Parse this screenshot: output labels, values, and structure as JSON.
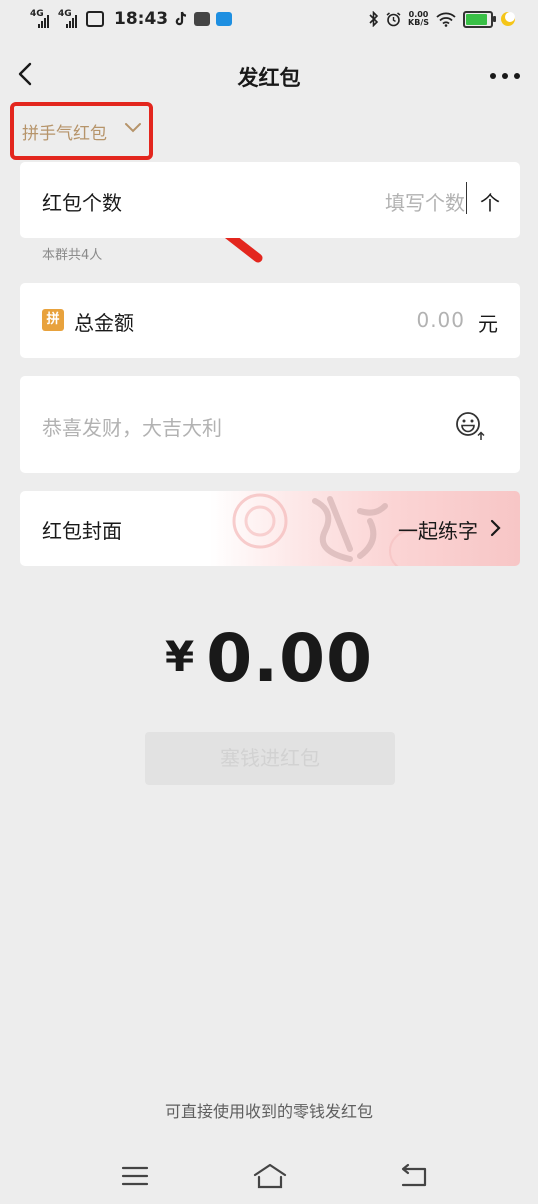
{
  "status_bar": {
    "sim1": "4G",
    "sim2": "4G",
    "time": "18:43",
    "net_speed_value": "0.00",
    "net_speed_unit": "KB/S",
    "battery_level": 0.8
  },
  "nav": {
    "title": "发红包"
  },
  "type_selector": {
    "label": "拼手气红包"
  },
  "count_row": {
    "label": "红包个数",
    "placeholder": "填写个数",
    "unit": "个",
    "group_hint": "本群共4人"
  },
  "amount_row": {
    "badge": "拼",
    "label": "总金额",
    "value": "0.00",
    "unit": "元"
  },
  "message_row": {
    "placeholder": "恭喜发财，大吉大利"
  },
  "cover_row": {
    "label": "红包封面",
    "selected": "一起练字"
  },
  "total": {
    "currency": "¥",
    "amount": "0.00"
  },
  "send_button": {
    "label": "塞钱进红包"
  },
  "footer": {
    "note": "可直接使用收到的零钱发红包"
  },
  "colors": {
    "background": "#ededed",
    "annotation_red": "#e3261e",
    "selector_text": "#b6946a",
    "badge": "#e8a23d"
  }
}
